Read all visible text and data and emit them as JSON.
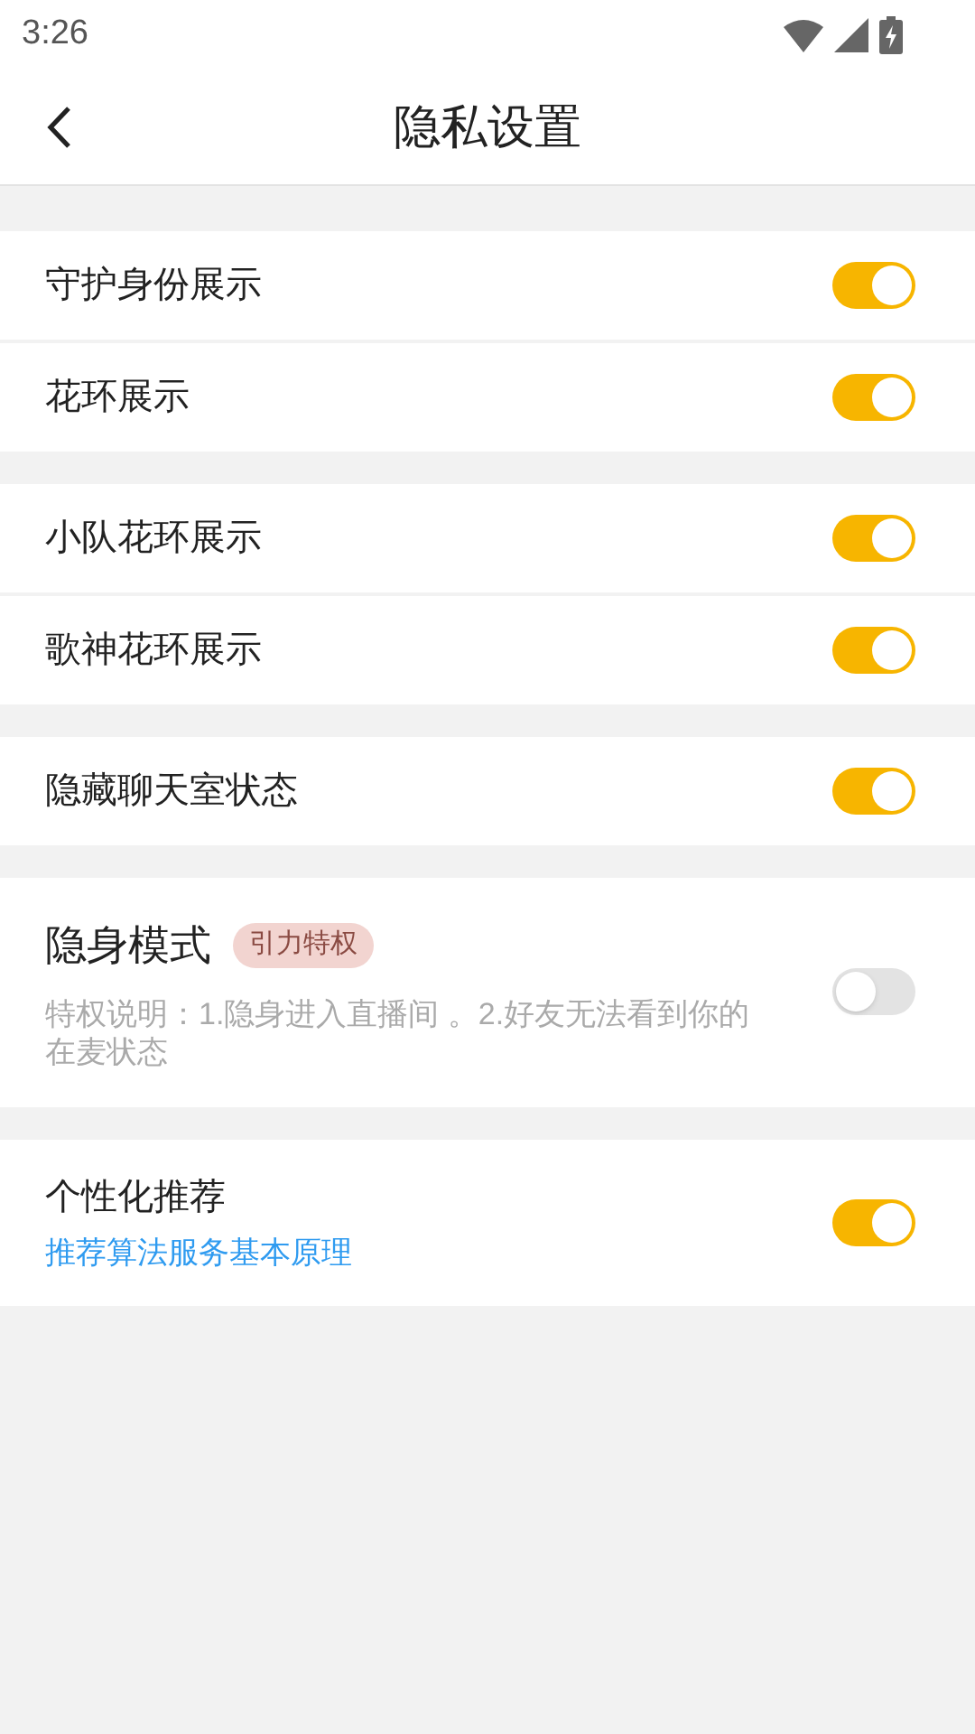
{
  "status_bar": {
    "time": "3:26"
  },
  "header": {
    "title": "隐私设置"
  },
  "groups": [
    {
      "rows": [
        {
          "label": "守护身份展示",
          "on": true
        },
        {
          "label": "花环展示",
          "on": true
        }
      ]
    },
    {
      "rows": [
        {
          "label": "小队花环展示",
          "on": true
        },
        {
          "label": "歌神花环展示",
          "on": true
        }
      ]
    },
    {
      "rows": [
        {
          "label": "隐藏聊天室状态",
          "on": true
        }
      ]
    },
    {
      "rows": [
        {
          "label": "隐身模式",
          "badge": "引力特权",
          "description": "特权说明：1.隐身进入直播间 。2.好友无法看到你的在麦状态",
          "on": false
        }
      ]
    },
    {
      "rows": [
        {
          "label": "个性化推荐",
          "link": "推荐算法服务基本原理",
          "on": true
        }
      ]
    }
  ]
}
